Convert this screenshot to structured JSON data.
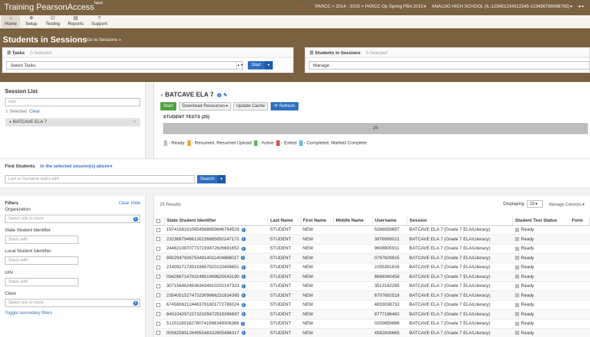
{
  "header": {
    "brand": "Training PearsonAccess",
    "brand_sup": "Next",
    "admin_path": "PARCC > 2014 - 2015 > PARCC Op Spring PBA 2015",
    "organization": "ANALOG HIGH SCHOOL (IL-123451234512345-123456789098765)",
    "user_icon": "user-icon"
  },
  "nav": {
    "items": [
      {
        "label": "Home",
        "icon": "home-icon"
      },
      {
        "label": "Setup",
        "icon": "gear-icon"
      },
      {
        "label": "Testing",
        "icon": "checklist-icon"
      },
      {
        "label": "Reports",
        "icon": "chart-icon"
      },
      {
        "label": "Support",
        "icon": "help-icon"
      }
    ]
  },
  "page": {
    "title": "Students in Sessions",
    "goto_link": "Go to Sessions »"
  },
  "tasks_panel": {
    "title": "Tasks",
    "selected": "0 Selected",
    "select_value": "Select Tasks",
    "start_button": "Start"
  },
  "students_panel": {
    "title": "Students in Sessions",
    "selected": "0 Selected",
    "select_value": "Manage"
  },
  "session_list": {
    "title": "Session List",
    "add_placeholder": "Add",
    "selected_text": "1 Selected",
    "clear_link": "Clear",
    "sessions": [
      "BATCAVE ELA 7"
    ]
  },
  "session_detail": {
    "name": "BATCAVE ELA 7",
    "start_button": "Start",
    "download_button": "Download Resources",
    "update_cache_button": "Update Cache",
    "refresh_button": "Refresh",
    "student_tests_label": "STUDENT TESTS (25)",
    "progress_total": "25",
    "legend": [
      {
        "label": "- Ready",
        "color": "#bdbdbd"
      },
      {
        "label": "- Resumed, Resumed Upload",
        "color": "#f0a830"
      },
      {
        "label": "- Active",
        "color": "#5cb85c"
      },
      {
        "label": "- Exited",
        "color": "#d9534f"
      },
      {
        "label": "- Completed, Marked Complete",
        "color": "#5bc0de"
      }
    ]
  },
  "find_students": {
    "label": "Find Students",
    "scope": "In the selected session(s) above",
    "search_placeholder": "Last or Surname starts with",
    "search_button": "Search"
  },
  "filters": {
    "title": "Filters",
    "clear_link": "Clear",
    "hide_link": "Hide",
    "organization_label": "Organization",
    "organization_placeholder": "Select one or more",
    "ssid_label": "State Student Identifier",
    "ssid_placeholder": "Starts with",
    "lsid_label": "Local Student Identifier",
    "lsid_placeholder": "Starts with",
    "uin_label": "UIN",
    "uin_placeholder": "Starts with",
    "class_label": "Class",
    "class_placeholder": "Select one or more",
    "toggle_link": "Toggle secondary filters"
  },
  "results": {
    "count": "25 Results",
    "displaying_label": "Displaying",
    "displaying_value": "25",
    "manage_columns": "Manage Columns",
    "columns": [
      "State Student Identifier",
      "Last Name",
      "First Name",
      "Middle Name",
      "Username",
      "Session",
      "Student Test Status",
      "Form"
    ],
    "rows": [
      [
        "19741581010854568859846764529",
        "STUDENT",
        "NEW",
        "",
        "5268059697",
        "BATCAVE ELA 7 (Grade 7 ELA/Literacy)",
        "Ready"
      ],
      [
        "23236979466130236885850247172",
        "STUDENT",
        "NEW",
        "",
        "3976999021",
        "BATCAVE ELA 7 (Grade 7 ELA/Literacy)",
        "Ready"
      ],
      [
        "24462108707737230872626691652",
        "STUDENT",
        "NEW",
        "",
        "9608905911",
        "BATCAVE ELA 7 (Grade 7 ELA/Literacy)",
        "Ready"
      ],
      [
        "99029479267534914011404888027",
        "STUDENT",
        "NEW",
        "",
        "0767829915",
        "BATCAVE ELA 7 (Grade 7 ELA/Literacy)",
        "Ready"
      ],
      [
        "21409271739193667920133408651",
        "STUDENT",
        "NEW",
        "",
        "2255381816",
        "BATCAVE ELA 7 (Grade 7 ELA/Literacy)",
        "Ready"
      ],
      [
        "09428671478324851969625043190",
        "STUDENT",
        "NEW",
        "",
        "8688360456",
        "BATCAVE ELA 7 (Grade 7 ELA/Literacy)",
        "Ready"
      ],
      [
        "30715646246363434910202147323",
        "STUDENT",
        "NEW",
        "",
        "3513142295",
        "BATCAVE ELA 7 (Grade 7 ELA/Literacy)",
        "Ready"
      ],
      [
        "23540515274732309866231834365",
        "STUDENT",
        "NEW",
        "",
        "6707692518",
        "BATCAVE ELA 7 (Grade 7 ELA/Literacy)",
        "Ready"
      ],
      [
        "67458062124463781801772786024",
        "STUDENT",
        "NEW",
        "",
        "4833038732",
        "BATCAVE ELA 7 (Grade 7 ELA/Literacy)",
        "Ready"
      ],
      [
        "84510429715732335672519396697",
        "STUDENT",
        "NEW",
        "",
        "8777196482",
        "BATCAVE ELA 7 (Grade 7 ELA/Literacy)",
        "Ready"
      ],
      [
        "51201180182780741088349006388",
        "STUDENT",
        "NEW",
        "",
        "0259859886",
        "BATCAVE ELA 7 (Grade 7 ELA/Literacy)",
        "Ready"
      ],
      [
        "00562585126495548332805496317",
        "STUDENT",
        "NEW",
        "",
        "4582839665",
        "BATCAVE ELA 7 (Grade 7 ELA/Literacy)",
        "Ready"
      ]
    ]
  }
}
